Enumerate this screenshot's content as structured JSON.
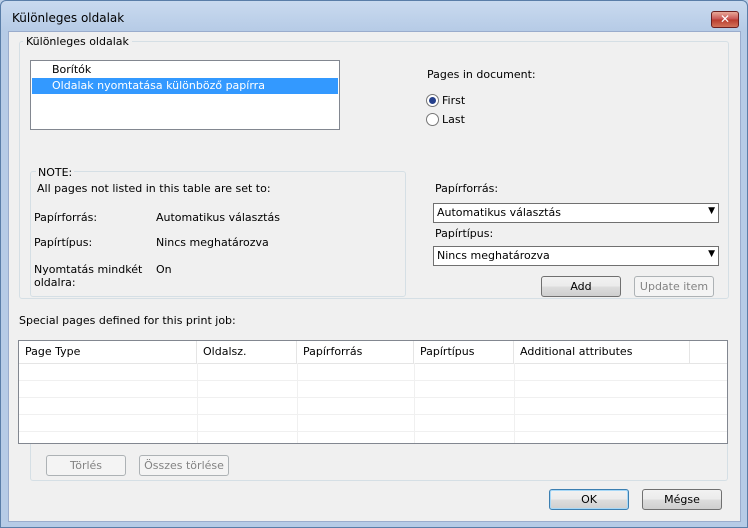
{
  "window": {
    "title": "Különleges oldalak",
    "close_label": "✕"
  },
  "group": {
    "label": "Különleges oldalak"
  },
  "page_list": [
    {
      "label": "Borítók"
    },
    {
      "label": "Oldalak nyomtatása különböző papírra"
    }
  ],
  "pages_in_document": {
    "label": "Pages in document:",
    "options": [
      {
        "label": "First",
        "checked": true
      },
      {
        "label": "Last",
        "checked": false
      }
    ]
  },
  "note": {
    "title": "NOTE:",
    "subtitle": "All pages not listed in this table are set to:",
    "rows": [
      {
        "label": "Papírforrás:",
        "value": "Automatikus választás"
      },
      {
        "label": "Papírtípus:",
        "value": "Nincs meghatározva"
      },
      {
        "label": "Nyomtatás mindkét\noldalra:",
        "value": "On"
      }
    ]
  },
  "right_panel": {
    "paper_source_label": "Papírforrás:",
    "paper_source_value": "Automatikus választás",
    "paper_type_label": "Papírtípus:",
    "paper_type_value": "Nincs meghatározva",
    "add_label": "Add",
    "update_label": "Update item"
  },
  "special_pages": {
    "label": "Special pages defined for this print job:",
    "columns": [
      "Page Type",
      "Oldalsz.",
      "Papírforrás",
      "Papírtípus",
      "Additional attributes"
    ]
  },
  "buttons": {
    "delete_label": "Törlés",
    "delete_all_label": "Összes törlése",
    "ok_label": "OK",
    "cancel_label": "Mégse"
  }
}
